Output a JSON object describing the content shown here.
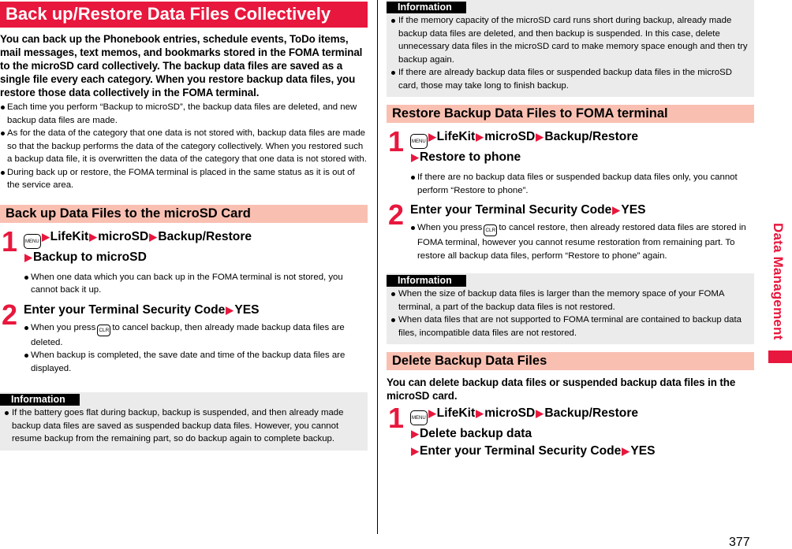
{
  "left": {
    "title": "Back up/Restore Data Files Collectively",
    "lead": "You can back up the Phonebook entries, schedule events, ToDo items, mail messages, text memos, and bookmarks stored in the FOMA terminal to the microSD card collectively. The backup data files are saved as a single file every each category. When you restore backup data files, you restore those data collectively in the FOMA terminal.",
    "bullets": [
      "Each time you perform “Backup to microSD”, the backup data files are deleted, and new backup data files are made.",
      "As for the data of the category that one data is not stored with, backup data files are made so that the backup performs the data of the category collectively. When you restored such a backup data file, it is overwritten the data of the category that one data is not stored with.",
      "During back up or restore, the FOMA terminal is placed in the same status as it is out of the service area."
    ],
    "section": {
      "title": "Back up Data Files to the microSD Card",
      "step1": {
        "num": "1",
        "key": "MENU",
        "path": [
          "LifeKit",
          "microSD",
          "Backup/Restore"
        ],
        "path2": "Backup to microSD",
        "bullets": [
          "When one data which you can back up in the FOMA terminal is not stored, you cannot back it up."
        ]
      },
      "step2": {
        "num": "2",
        "line": "Enter your Terminal Security Code",
        "action": "YES",
        "bullet1_pre": "When you press",
        "key": "CLR",
        "bullet1_post": "to cancel backup, then already made backup data files are deleted.",
        "bullet2": "When backup is completed, the save date and time of the backup data files are displayed."
      }
    },
    "info": {
      "label": "Information",
      "bullets": [
        "If the battery goes flat during backup, backup is suspended, and then already made backup data files are saved as suspended backup data files. However, you cannot resume backup from the remaining part, so do backup again to complete backup."
      ]
    }
  },
  "right": {
    "info1": {
      "label": "Information",
      "bullets": [
        "If the memory capacity of the microSD card runs short during backup, already made backup data files are deleted, and then backup is suspended. In this case, delete unnecessary data files in the microSD card to make memory space enough and then try backup again.",
        "If there are already backup data files or suspended backup data files in the microSD card, those may take long to finish backup."
      ]
    },
    "restore": {
      "title": "Restore Backup Data Files to FOMA terminal",
      "step1": {
        "num": "1",
        "key": "MENU",
        "path": [
          "LifeKit",
          "microSD",
          "Backup/Restore"
        ],
        "path2": "Restore to phone",
        "bullets": [
          "If there are no backup data files or suspended backup data files only, you cannot perform “Restore to phone”."
        ]
      },
      "step2": {
        "num": "2",
        "line": "Enter your Terminal Security Code",
        "action": "YES",
        "bullet1_pre": "When you press",
        "key": "CLR",
        "bullet1_post": "to cancel restore, then already restored data files are stored in FOMA terminal, however you cannot resume restoration from remaining part. To restore all backup data files, perform “Restore to phone” again."
      }
    },
    "info2": {
      "label": "Information",
      "bullets": [
        "When the size of backup data files is larger than the memory space of your FOMA terminal, a part of the backup data files is not restored.",
        "When data files that are not supported to FOMA terminal are contained to backup data files, incompatible data files are not restored."
      ]
    },
    "delete": {
      "title": "Delete Backup Data Files",
      "lead": "You can delete backup data files or suspended backup data files in the microSD card.",
      "step1": {
        "num": "1",
        "key": "MENU",
        "path": [
          "LifeKit",
          "microSD",
          "Backup/Restore"
        ],
        "path2": "Delete backup data",
        "path3": "Enter your Terminal Security Code",
        "action": "YES"
      }
    }
  },
  "side_tab": "Data Management",
  "page_number": "377",
  "colors": {
    "accent": "#e8173d",
    "section": "#f9c0b2",
    "info_bg": "#ebebeb"
  }
}
